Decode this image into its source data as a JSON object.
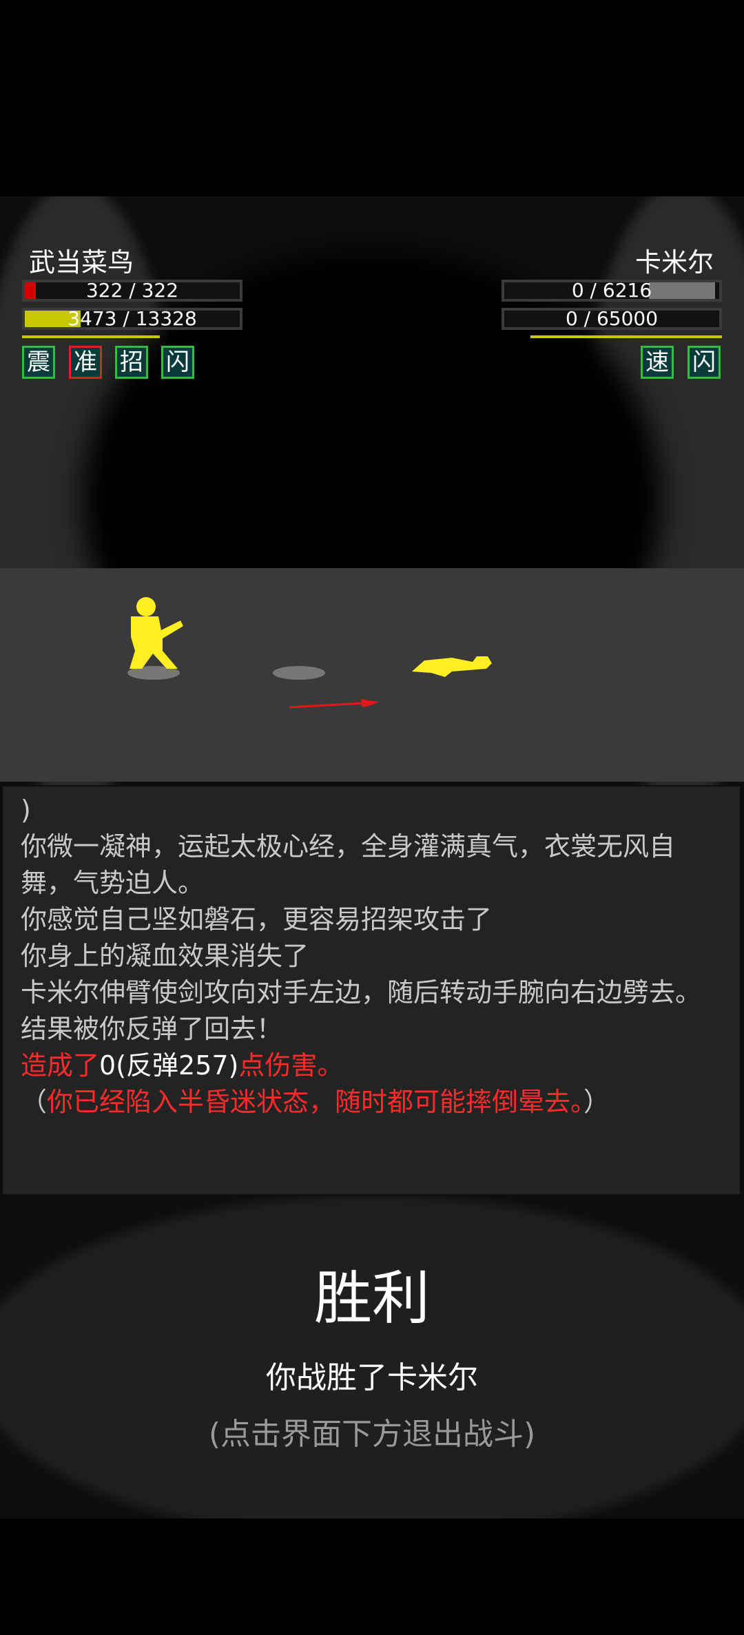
{
  "player": {
    "name": "武当菜鸟",
    "hp_text": "322 / 322",
    "hp_fraction": 0.05,
    "mp_text": "3473 / 13328",
    "mp_fraction": 0.26,
    "skills": [
      "震",
      "准",
      "招",
      "闪"
    ]
  },
  "enemy": {
    "name": "卡米尔",
    "hp_text": "0 / 6216",
    "mp_text": "0 / 65000",
    "skills": [
      "速",
      "闪"
    ]
  },
  "log": {
    "lines": [
      ")",
      "你微一凝神，运起太极心经，全身灌满真气，衣裳无风自舞，气势迫人。",
      "你感觉自己坚如磐石，更容易招架攻击了",
      "你身上的凝血效果消失了",
      "卡米尔伸臂使剑攻向对手左边，随后转动手腕向右边劈去。",
      "结果被你反弹了回去！"
    ],
    "damage_prefix": "造成了",
    "damage_value": "0(反弹257)",
    "damage_suffix": "点伤害。",
    "status_open": "（",
    "status_text": "你已经陷入半昏迷状态，随时都可能摔倒晕去。",
    "status_close": "）"
  },
  "result": {
    "title": "胜利",
    "message": "你战胜了卡米尔",
    "hint": "(点击界面下方退出战斗)"
  },
  "colors": {
    "hp": "#d40000",
    "mp": "#c8c800",
    "skill_border": "#2fbf3f",
    "log_red": "#ff2a2a"
  }
}
